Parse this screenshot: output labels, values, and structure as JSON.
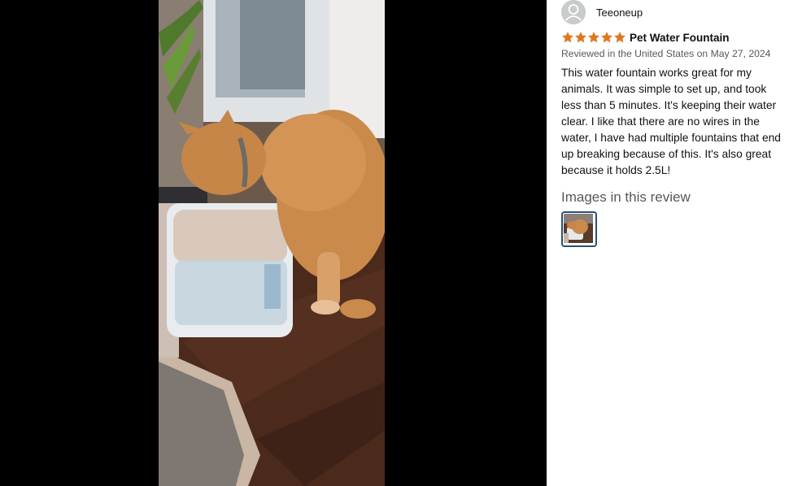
{
  "viewer": {
    "image_description_icon": "cat-photo"
  },
  "review": {
    "author": "Teeoneup",
    "rating": 5,
    "rating_max": 5,
    "title": "Pet Water Fountain",
    "meta": "Reviewed in the United States on May 27, 2024",
    "body": "This water fountain works great for my animals. It was simple to set up, and took less than 5 minutes. It's keeping their water clear. I like that there are no wires in the water, I have had multiple fountains that end up breaking because of this. It's also great because it holds 2.5L!",
    "images_heading": "Images in this review",
    "images_count": 1
  },
  "colors": {
    "star": "#de7921",
    "link_border": "#27517a",
    "meta_text": "#565959",
    "viewer_background": "#000000"
  },
  "icons": {
    "avatar": "person-icon",
    "star": "star-icon"
  }
}
